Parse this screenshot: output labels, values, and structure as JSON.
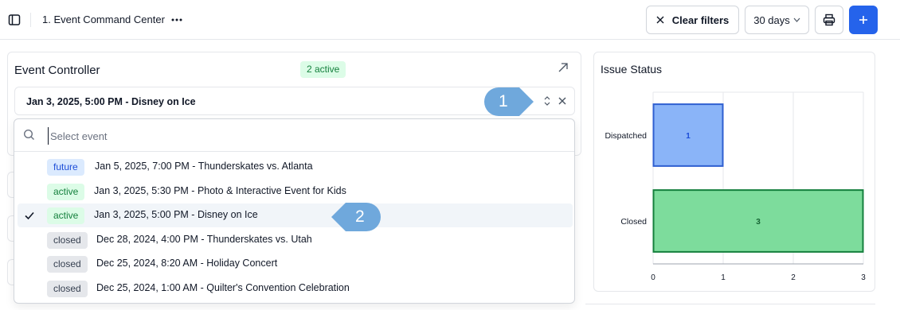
{
  "header": {
    "page_title": "1. Event Command Center",
    "clear_filters_label": "Clear filters",
    "range_label": "30 days",
    "add_label": "+"
  },
  "controller": {
    "title": "Event Controller",
    "active_badge": "2 active",
    "selected_value": "Jan 3, 2025, 5:00 PM - Disney on Ice"
  },
  "dropdown": {
    "placeholder": "Select event",
    "options": [
      {
        "status": "future",
        "label": "Jan 5, 2025, 7:00 PM - Thunderskates vs. Atlanta",
        "selected": false
      },
      {
        "status": "active",
        "label": "Jan 3, 2025, 5:30 PM - Photo & Interactive Event for Kids",
        "selected": false
      },
      {
        "status": "active",
        "label": "Jan 3, 2025, 5:00 PM - Disney on Ice",
        "selected": true
      },
      {
        "status": "closed",
        "label": "Dec 28, 2024, 4:00 PM - Thunderskates vs. Utah",
        "selected": false
      },
      {
        "status": "closed",
        "label": "Dec 25, 2024, 8:20 AM - Holiday Concert",
        "selected": false
      },
      {
        "status": "closed",
        "label": "Dec 25, 2024, 1:00 AM - Quilter's Convention Celebration",
        "selected": false
      }
    ]
  },
  "callouts": {
    "first": "1",
    "second": "2"
  },
  "issue_status": {
    "title": "Issue Status"
  },
  "chart_data": {
    "type": "bar",
    "orientation": "horizontal",
    "title": "Issue Status",
    "categories": [
      "Dispatched",
      "Closed"
    ],
    "values": [
      1,
      3
    ],
    "data_labels": [
      "1",
      "3"
    ],
    "xlim": [
      0,
      3
    ],
    "x_ticks": [
      "0",
      "1",
      "2",
      "3"
    ],
    "grid": true,
    "colors": {
      "Dispatched": "#8ab4f8",
      "Closed": "#7ddc9c"
    },
    "border_colors": {
      "Dispatched": "#2f5fd0",
      "Closed": "#15803d"
    },
    "label_colors": {
      "Dispatched": "#1d4ed8",
      "Closed": "#166534"
    }
  },
  "colors": {
    "accent": "#2563eb",
    "callout": "#6fa8dc"
  }
}
